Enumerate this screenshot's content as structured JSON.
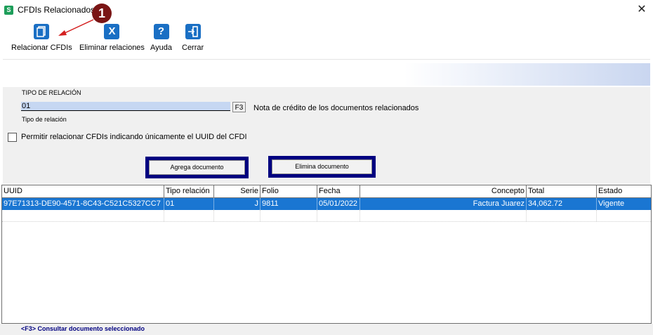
{
  "window": {
    "title": "CFDIs Relacionados",
    "close_glyph": "✕",
    "app_icon_glyph": "S"
  },
  "callout": {
    "number": "1"
  },
  "toolbar": {
    "relacionar_label": "Relacionar CFDIs",
    "eliminar_label": "Eliminar relaciones",
    "ayuda_label": "Ayuda",
    "cerrar_label": "Cerrar",
    "eliminar_icon_glyph": "X",
    "ayuda_icon_glyph": "?"
  },
  "relacion": {
    "heading": "TIPO DE RELACIÓN",
    "value": "01",
    "f3_label": "F3",
    "description": "Nota de crédito de los documentos relacionados",
    "sublabel": "Tipo de relación"
  },
  "options": {
    "uuid_only_label": "Permitir relacionar CFDIs indicando únicamente el UUID del CFDI",
    "uuid_only_checked": false
  },
  "actions": {
    "agrega_label": "Agrega documento",
    "elimina_label": "Elimina documento"
  },
  "grid": {
    "columns": [
      "UUID",
      "Tipo relación",
      "Serie",
      "Folio",
      "Fecha",
      "Concepto",
      "Total",
      "Estado"
    ],
    "rows": [
      {
        "uuid": "97E71313-DE90-4571-8C43-C521C5327CC7",
        "tipo": "01",
        "serie": "J",
        "folio": "9811",
        "fecha": "05/01/2022",
        "concepto": "Factura Juarez",
        "total": "34,062.72",
        "estado": "Vigente"
      }
    ]
  },
  "status": {
    "text": "<F3> Consultar documento seleccionado"
  },
  "colors": {
    "selection": "#1a76d2",
    "icon_blue": "#1a6fc4",
    "action_border": "#000080",
    "callout": "#7a1515",
    "app_icon": "#1e9e5a"
  }
}
